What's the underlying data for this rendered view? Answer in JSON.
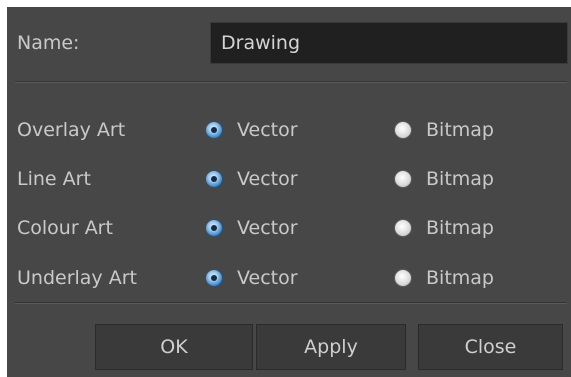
{
  "dialog": {
    "name_label": "Name:",
    "name_value": "Drawing"
  },
  "rows": [
    {
      "label": "Overlay Art",
      "option_vector": "Vector",
      "option_bitmap": "Bitmap",
      "selected": "Vector"
    },
    {
      "label": "Line Art",
      "option_vector": "Vector",
      "option_bitmap": "Bitmap",
      "selected": "Vector"
    },
    {
      "label": "Colour Art",
      "option_vector": "Vector",
      "option_bitmap": "Bitmap",
      "selected": "Vector"
    },
    {
      "label": "Underlay Art",
      "option_vector": "Vector",
      "option_bitmap": "Bitmap",
      "selected": "Vector"
    }
  ],
  "buttons": {
    "ok": "OK",
    "apply": "Apply",
    "close": "Close"
  },
  "colors": {
    "dialog_bg": "#474747",
    "input_bg": "#202020",
    "button_bg": "#3a3a3a",
    "text": "#c9c9c9",
    "radio_selected": "#3b86c9"
  }
}
